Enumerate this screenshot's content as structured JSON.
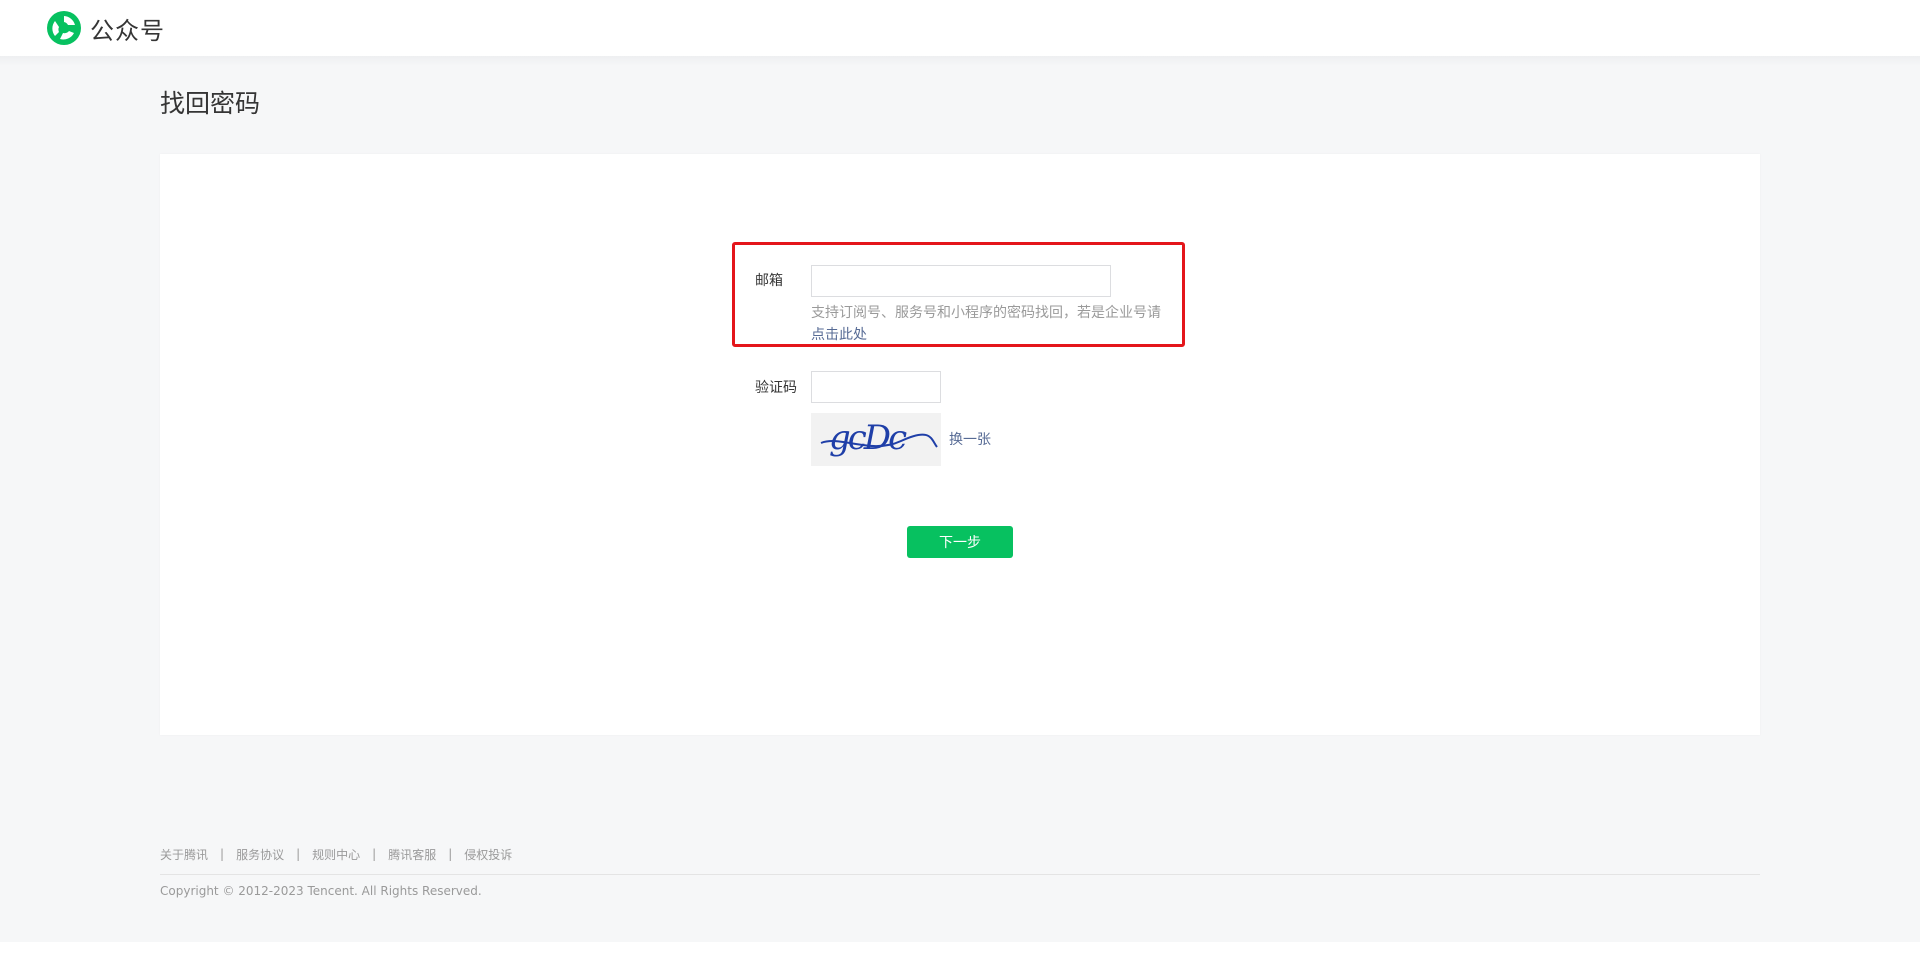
{
  "header": {
    "logo_text": "公众号"
  },
  "page": {
    "title": "找回密码"
  },
  "form": {
    "email_label": "邮箱",
    "email_value": "",
    "email_hint": "支持订阅号、服务号和小程序的密码找回，若是企业号请",
    "email_hint_link": "点击此处",
    "code_label": "验证码",
    "code_value": "",
    "captcha_text": "gcDc",
    "refresh_label": "换一张",
    "next_label": "下一步"
  },
  "footer": {
    "links": [
      "关于腾讯",
      "服务协议",
      "规则中心",
      "腾讯客服",
      "侵权投诉"
    ],
    "separator": "|",
    "copyright": "Copyright © 2012-2023 Tencent. All Rights Reserved."
  },
  "colors": {
    "brand_green": "#07c160",
    "highlight_red": "#e4161b",
    "link_blue": "#576b95",
    "page_gray": "#f6f7f8"
  }
}
